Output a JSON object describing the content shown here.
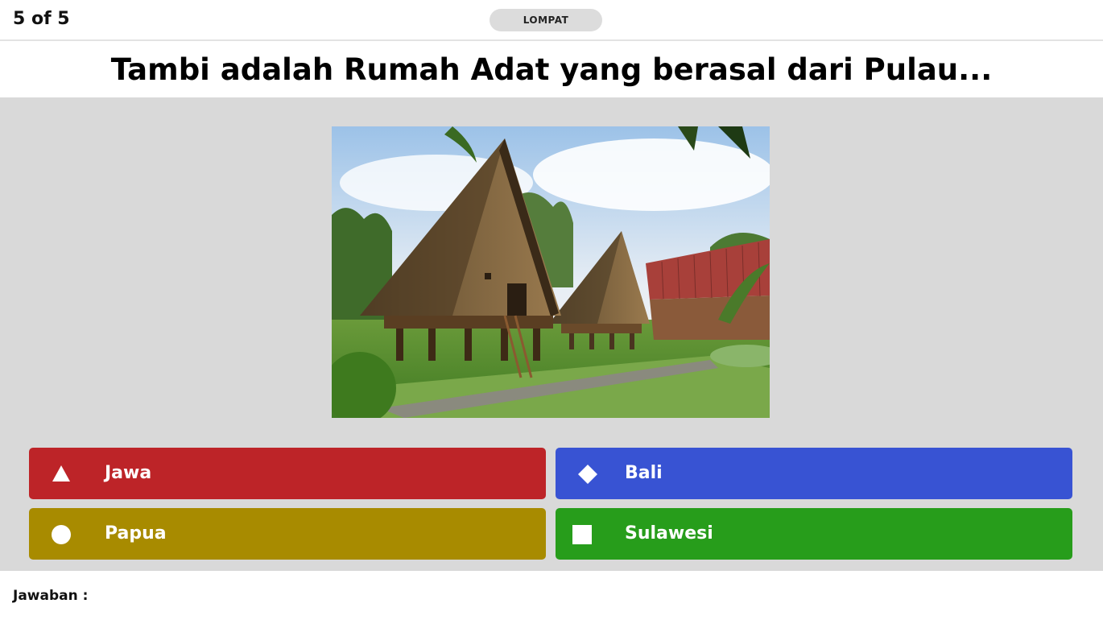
{
  "header": {
    "progress": "5 of 5",
    "skip_label": "LOMPAT"
  },
  "question": {
    "text": "Tambi adalah Rumah Adat yang berasal dari Pulau..."
  },
  "answers": [
    {
      "label": "Jawa",
      "icon": "triangle-icon",
      "color": "#bd2428"
    },
    {
      "label": "Bali",
      "icon": "diamond-icon",
      "color": "#3853d3"
    },
    {
      "label": "Papua",
      "icon": "circle-icon",
      "color": "#a88b00"
    },
    {
      "label": "Sulawesi",
      "icon": "square-icon",
      "color": "#279d1b"
    }
  ],
  "footer": {
    "answer_label": "Jawaban :"
  }
}
